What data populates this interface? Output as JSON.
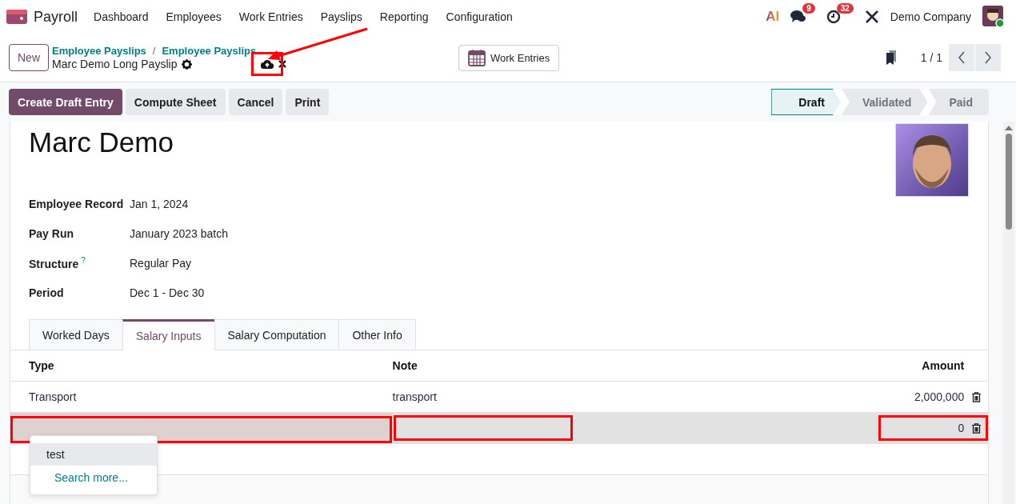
{
  "navbar": {
    "app": "Payroll",
    "menu": [
      "Dashboard",
      "Employees",
      "Work Entries",
      "Payslips",
      "Reporting",
      "Configuration"
    ],
    "ai_label": "AI",
    "messages_badge": "9",
    "activities_badge": "32",
    "company": "Demo Company"
  },
  "control_panel": {
    "new_button": "New",
    "breadcrumbs": [
      "Employee Payslips",
      "Employee Payslips"
    ],
    "breadcrumb_separator": "/",
    "record": "Marc Demo Long Payslip",
    "work_entries_button": "Work Entries",
    "pager": "1 / 1"
  },
  "actions": [
    {
      "label": "Create Draft Entry",
      "primary": true
    },
    {
      "label": "Compute Sheet",
      "primary": false
    },
    {
      "label": "Cancel",
      "primary": false
    },
    {
      "label": "Print",
      "primary": false
    }
  ],
  "statusbar": [
    {
      "label": "Draft",
      "selected": true
    },
    {
      "label": "Validated",
      "selected": false
    },
    {
      "label": "Paid",
      "selected": false
    }
  ],
  "employee_name": "Marc Demo",
  "fields": [
    {
      "label": "Employee Record",
      "value": "Jan 1, 2024"
    },
    {
      "label": "Pay Run",
      "value": "January 2023 batch"
    },
    {
      "label": "Structure",
      "help": "?",
      "value": "Regular Pay"
    },
    {
      "label": "Period",
      "value": "Dec 1 - Dec 30"
    }
  ],
  "tabs": [
    {
      "label": "Worked Days",
      "selected": false
    },
    {
      "label": "Salary Inputs",
      "selected": true
    },
    {
      "label": "Salary Computation",
      "selected": false
    },
    {
      "label": "Other Info",
      "selected": false
    }
  ],
  "table": {
    "columns": [
      "Type",
      "Note",
      "Amount"
    ],
    "rows": [
      {
        "type": "Transport",
        "note": "transport",
        "amount": "2,000,000",
        "editing": false
      },
      {
        "amount": "0",
        "editing": true
      }
    ]
  },
  "dropdown": {
    "items": [
      {
        "label": "test",
        "selected": true
      }
    ],
    "search_more": "Search more..."
  }
}
